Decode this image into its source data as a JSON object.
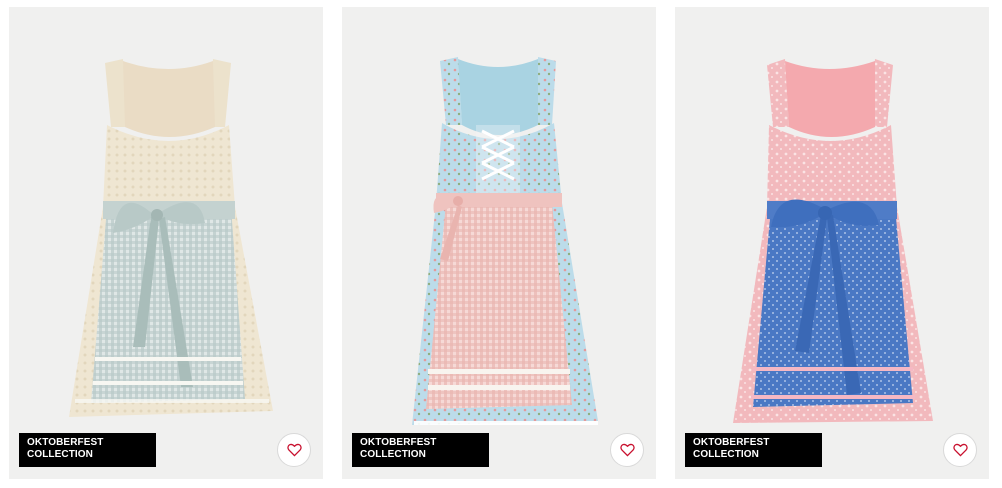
{
  "products": [
    {
      "badge_line1": "OKTOBERFEST",
      "badge_line2": "COLLECTION",
      "favorite_icon": "heart-icon",
      "image": "dirndl dress, cream bodice with light blue gingham apron"
    },
    {
      "badge_line1": "OKTOBERFEST",
      "badge_line2": "COLLECTION",
      "favorite_icon": "heart-icon",
      "image": "dirndl dress, light blue floral bodice with pink gingham apron"
    },
    {
      "badge_line1": "OKTOBERFEST",
      "badge_line2": "COLLECTION",
      "favorite_icon": "heart-icon",
      "image": "dirndl dress, pink floral bodice with blue patterned apron"
    }
  ],
  "colors": {
    "card_bg": "#f0f0ef",
    "badge_bg": "#000000",
    "badge_text": "#ffffff",
    "heart": "#c8102e"
  }
}
